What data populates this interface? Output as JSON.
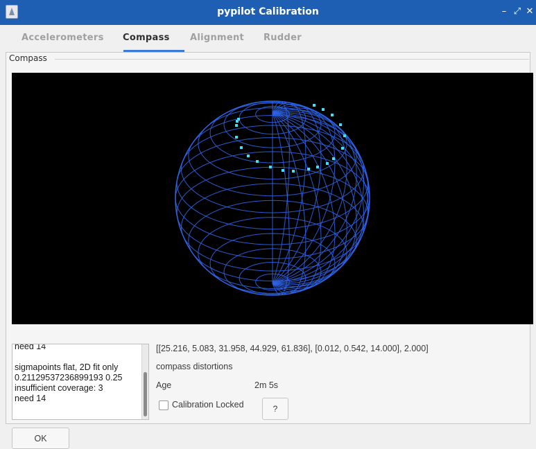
{
  "window": {
    "title": "pypilot Calibration",
    "controls": [
      "–",
      "⤢",
      "✕"
    ]
  },
  "tabs": [
    {
      "label": "Accelerometers",
      "active": false
    },
    {
      "label": "Compass",
      "active": true
    },
    {
      "label": "Alignment",
      "active": false
    },
    {
      "label": "Rudder",
      "active": false
    }
  ],
  "compass": {
    "group_label": "Compass",
    "log_text": "need 14\n\nsigmapoints flat, 2D fit only\n0.21129537236899193 0.25\ninsufficient coverage: 3\nneed 14",
    "calibration_values": "[[25.216, 5.083, 31.958, 44.929, 61.836], [0.012, 0.542, 14.000], 2.000]",
    "distortions_label": "compass distortions",
    "age_label": "Age",
    "age_value": "2m 5s",
    "calibration_locked_label": "Calibration Locked",
    "calibration_locked": false,
    "help_label": "?"
  },
  "footer": {
    "ok_label": "OK"
  },
  "colors": {
    "titlebar": "#1f5fb3",
    "tab_accent": "#3a7bd5",
    "sphere_wire": "#2f64e8",
    "points": "#40e0f0"
  }
}
